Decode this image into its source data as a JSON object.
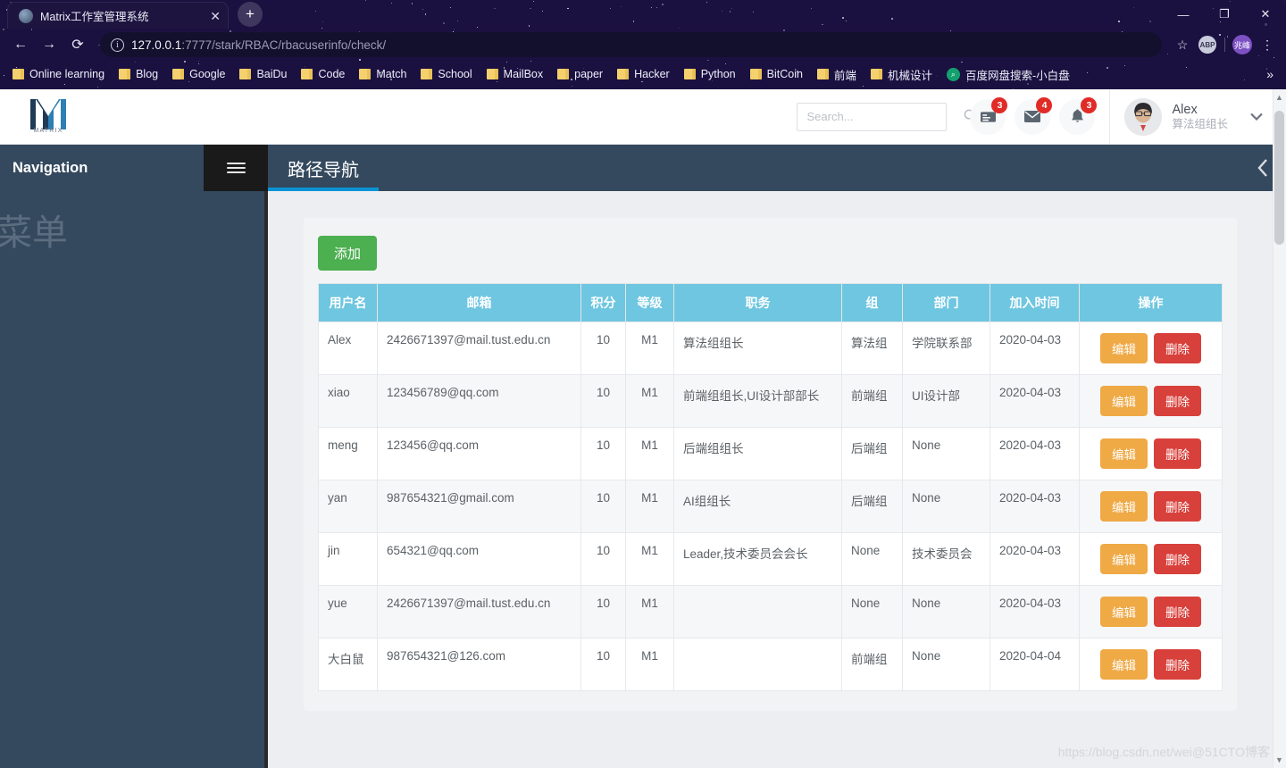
{
  "browser": {
    "tab": {
      "title": "Matrix工作室管理系统",
      "close_label": "✕",
      "favicon": "globe-icon"
    },
    "new_tab_label": "+",
    "window_controls": {
      "minimize": "—",
      "maximize": "❐",
      "close": "✕"
    },
    "nav": {
      "back": "←",
      "forward": "→",
      "reload": "⟳"
    },
    "url": {
      "host": "127.0.0.1",
      "rest": ":7777/stark/RBAC/rbacuserinfo/check/",
      "full": "127.0.0.1:7777/stark/RBAC/rbacuserinfo/check/"
    },
    "toolbar": {
      "bookmark_star": "☆",
      "extension": "ABP",
      "profile": "兆峰",
      "menu": "⋮"
    },
    "bookmarks": [
      {
        "label": "Online learning",
        "icon": "folder-icon"
      },
      {
        "label": "Blog",
        "icon": "folder-icon"
      },
      {
        "label": "Google",
        "icon": "folder-icon"
      },
      {
        "label": "BaiDu",
        "icon": "folder-icon"
      },
      {
        "label": "Code",
        "icon": "folder-icon"
      },
      {
        "label": "Match",
        "icon": "folder-icon"
      },
      {
        "label": "School",
        "icon": "folder-icon"
      },
      {
        "label": "MailBox",
        "icon": "folder-icon"
      },
      {
        "label": "paper",
        "icon": "folder-icon"
      },
      {
        "label": "Hacker",
        "icon": "folder-icon"
      },
      {
        "label": "Python",
        "icon": "folder-icon"
      },
      {
        "label": "BitCoin",
        "icon": "folder-icon"
      },
      {
        "label": "前端",
        "icon": "folder-icon"
      },
      {
        "label": "机械设计",
        "icon": "folder-icon"
      },
      {
        "label": "百度网盘搜索-小白盘",
        "icon": "baidu-search-icon"
      }
    ],
    "bookmarks_overflow": "»"
  },
  "app": {
    "logo": {
      "mark": "M",
      "text": "MATRIX"
    },
    "search": {
      "placeholder": "Search...",
      "value": "",
      "icon": "search-icon"
    },
    "notifications": [
      {
        "icon": "tasks-icon",
        "count": "3"
      },
      {
        "icon": "envelope-icon",
        "count": "4"
      },
      {
        "icon": "bell-icon",
        "count": "3"
      }
    ],
    "user": {
      "name": "Alex",
      "role": "算法组组长",
      "caret": "⌄",
      "avatar": "user-photo"
    },
    "navbar": {
      "sidebar_title": "Navigation",
      "hamburger": "menu-icon",
      "breadcrumb": "路径导航",
      "collapse": "‹"
    },
    "sidebar": {
      "menu_text": "菜单"
    },
    "content": {
      "add_button": "添加",
      "table": {
        "headers": [
          "用户名",
          "邮箱",
          "积分",
          "等级",
          "职务",
          "组",
          "部门",
          "加入时间",
          "操作"
        ],
        "actions": {
          "edit": "编辑",
          "delete": "删除"
        },
        "rows": [
          {
            "username": "Alex",
            "email": "2426671397@mail.tust.edu.cn",
            "points": "10",
            "level": "M1",
            "position": "算法组组长",
            "group": "算法组",
            "department": "学院联系部",
            "join_date": "2020-04-03"
          },
          {
            "username": "xiao",
            "email": "123456789@qq.com",
            "points": "10",
            "level": "M1",
            "position": "前端组组长,UI设计部部长",
            "group": "前端组",
            "department": "UI设计部",
            "join_date": "2020-04-03"
          },
          {
            "username": "meng",
            "email": "123456@qq.com",
            "points": "10",
            "level": "M1",
            "position": "后端组组长",
            "group": "后端组",
            "department": "None",
            "join_date": "2020-04-03"
          },
          {
            "username": "yan",
            "email": "987654321@gmail.com",
            "points": "10",
            "level": "M1",
            "position": "AI组组长",
            "group": "后端组",
            "department": "None",
            "join_date": "2020-04-03"
          },
          {
            "username": "jin",
            "email": "654321@qq.com",
            "points": "10",
            "level": "M1",
            "position": "Leader,技术委员会会长",
            "group": "None",
            "department": "技术委员会",
            "join_date": "2020-04-03"
          },
          {
            "username": "yue",
            "email": "2426671397@mail.tust.edu.cn",
            "points": "10",
            "level": "M1",
            "position": "",
            "group": "None",
            "department": "None",
            "join_date": "2020-04-03"
          },
          {
            "username": "大白鼠",
            "email": "987654321@126.com",
            "points": "10",
            "level": "M1",
            "position": "",
            "group": "前端组",
            "department": "None",
            "join_date": "2020-04-04"
          }
        ]
      }
    },
    "watermark": "https://blog.csdn.net/wei@51CTO博客"
  },
  "colors": {
    "accent_blue": "#0b93d5",
    "sidebar": "#34495e",
    "table_header": "#6ec6e0",
    "add_button": "#4caf50",
    "edit_button": "#efa945",
    "delete_button": "#d8403b",
    "badge_red": "#e02b27"
  }
}
